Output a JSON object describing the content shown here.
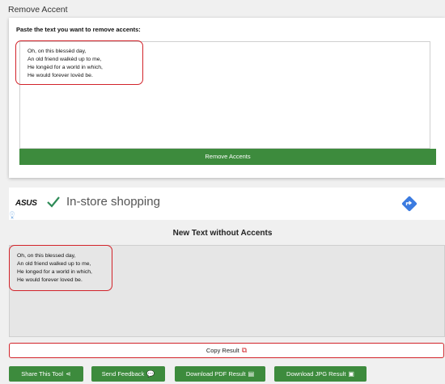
{
  "page": {
    "title": "Remove Accent"
  },
  "input": {
    "label": "Paste the text you want to remove accents:",
    "lines": [
      "Oh, on this blessèd day,",
      "An old friend walkèd up to me,",
      "He longèd for a world in which,",
      "He would forever lovèd be."
    ]
  },
  "remove_button": {
    "label": "Remove Accents"
  },
  "ad": {
    "brand": "ASUS",
    "text": "In-store shopping",
    "icons": [
      "info-icon",
      "close-icon",
      "check-icon",
      "directions-icon"
    ]
  },
  "result": {
    "heading": "New Text without Accents",
    "lines": [
      "Oh, on this blessed day,",
      "An old friend walked up to me,",
      "He longed for a world in which,",
      "He would forever loved be."
    ]
  },
  "copy_button": {
    "label": "Copy Result",
    "icon": "copy-icon"
  },
  "actions": [
    {
      "label": "Share This Tool",
      "icon": "share-icon"
    },
    {
      "label": "Send Feedback",
      "icon": "chat-icon"
    },
    {
      "label": "Download PDF Result",
      "icon": "pdf-icon"
    },
    {
      "label": "Download JPG Result",
      "icon": "image-icon"
    }
  ],
  "colors": {
    "green": "#3d8b3d",
    "red": "#d2232a"
  }
}
